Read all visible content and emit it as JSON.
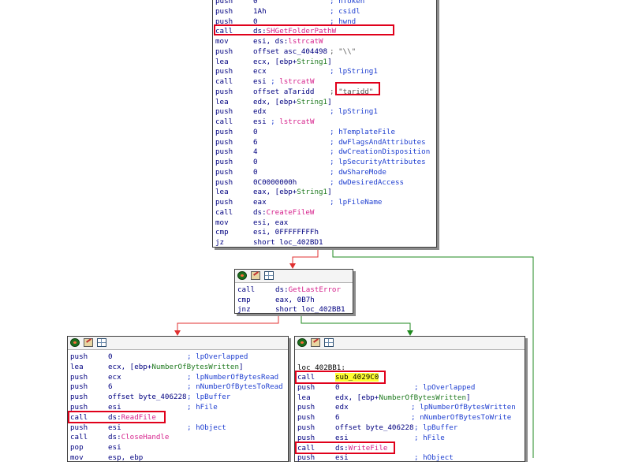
{
  "colors": {
    "edge_false": "#e03030",
    "edge_true": "#1f8a1f",
    "edge_other": "#1f8a1f",
    "highlight_box": "#e0001b",
    "highlight_fill": "#ffff33"
  },
  "toolbar_icons": [
    "graph-overview-icon",
    "edit-block-icon",
    "node-grid-icon"
  ],
  "block_main": {
    "lines": [
      {
        "mn": "push",
        "op": "0",
        "cm": "; hToken"
      },
      {
        "mn": "push",
        "op": "1Ah",
        "cm": "; csidl"
      },
      {
        "mn": "push",
        "op": "0",
        "cm": "; hwnd"
      },
      {
        "mn": "call",
        "op": "ds:SHGetFolderPathW",
        "cm": ""
      },
      {
        "mn": "mov",
        "op": "esi, ds:lstrcatW",
        "cm": ""
      },
      {
        "mn": "push",
        "op": "offset asc_404498",
        "cm": "; \"\\\\\""
      },
      {
        "mn": "lea",
        "op": "ecx, [ebp+String1]",
        "cm": ""
      },
      {
        "mn": "push",
        "op": "ecx",
        "cm": "; lpString1"
      },
      {
        "mn": "call",
        "op": "esi ; lstrcatW",
        "cm": ""
      },
      {
        "mn": "push",
        "op": "offset aTaridd",
        "cm": "; \"taridd\""
      },
      {
        "mn": "lea",
        "op": "edx, [ebp+String1]",
        "cm": ""
      },
      {
        "mn": "push",
        "op": "edx",
        "cm": "; lpString1"
      },
      {
        "mn": "call",
        "op": "esi ; lstrcatW",
        "cm": ""
      },
      {
        "mn": "push",
        "op": "0",
        "cm": "; hTemplateFile"
      },
      {
        "mn": "push",
        "op": "6",
        "cm": "; dwFlagsAndAttributes"
      },
      {
        "mn": "push",
        "op": "4",
        "cm": "; dwCreationDisposition"
      },
      {
        "mn": "push",
        "op": "0",
        "cm": "; lpSecurityAttributes"
      },
      {
        "mn": "push",
        "op": "0",
        "cm": "; dwShareMode"
      },
      {
        "mn": "push",
        "op": "0C0000000h",
        "cm": "; dwDesiredAccess"
      },
      {
        "mn": "lea",
        "op": "eax, [ebp+String1]",
        "cm": ""
      },
      {
        "mn": "push",
        "op": "eax",
        "cm": "; lpFileName"
      },
      {
        "mn": "call",
        "op": "ds:CreateFileW",
        "cm": ""
      },
      {
        "mn": "mov",
        "op": "esi, eax",
        "cm": ""
      },
      {
        "mn": "cmp",
        "op": "esi, 0FFFFFFFFh",
        "cm": ""
      },
      {
        "mn": "jz",
        "op": "short loc_402BD1",
        "cm": ""
      }
    ]
  },
  "block_check": {
    "lines": [
      {
        "mn": "call",
        "op": "ds:GetLastError",
        "cm": ""
      },
      {
        "mn": "cmp",
        "op": "eax, 0B7h",
        "cm": ""
      },
      {
        "mn": "jnz",
        "op": "short loc_402BB1",
        "cm": ""
      }
    ]
  },
  "block_left": {
    "lines": [
      {
        "mn": "push",
        "op": "0",
        "cm": "; lpOverlapped"
      },
      {
        "mn": "lea",
        "op": "ecx, [ebp+NumberOfBytesWritten]",
        "cm": ""
      },
      {
        "mn": "push",
        "op": "ecx",
        "cm": "; lpNumberOfBytesRead"
      },
      {
        "mn": "push",
        "op": "6",
        "cm": "; nNumberOfBytesToRead"
      },
      {
        "mn": "push",
        "op": "offset byte_406228",
        "cm": "; lpBuffer"
      },
      {
        "mn": "push",
        "op": "esi",
        "cm": "; hFile"
      },
      {
        "mn": "call",
        "op": "ds:ReadFile",
        "cm": ""
      },
      {
        "mn": "push",
        "op": "esi",
        "cm": "; hObject"
      },
      {
        "mn": "call",
        "op": "ds:CloseHandle",
        "cm": ""
      },
      {
        "mn": "pop",
        "op": "esi",
        "cm": ""
      },
      {
        "mn": "mov",
        "op": "esp, ebp",
        "cm": ""
      }
    ]
  },
  "block_right": {
    "label": "loc_402BB1:",
    "lines": [
      {
        "mn": "call",
        "op": "sub_4029C0",
        "cm": ""
      },
      {
        "mn": "push",
        "op": "0",
        "cm": "; lpOverlapped"
      },
      {
        "mn": "lea",
        "op": "edx, [ebp+NumberOfBytesWritten]",
        "cm": ""
      },
      {
        "mn": "push",
        "op": "edx",
        "cm": "; lpNumberOfBytesWritten"
      },
      {
        "mn": "push",
        "op": "6",
        "cm": "; nNumberOfBytesToWrite"
      },
      {
        "mn": "push",
        "op": "offset byte_406228",
        "cm": "; lpBuffer"
      },
      {
        "mn": "push",
        "op": "esi",
        "cm": "; hFile"
      },
      {
        "mn": "call",
        "op": "ds:WriteFile",
        "cm": ""
      },
      {
        "mn": "push",
        "op": "esi",
        "cm": "; hObject"
      }
    ]
  }
}
